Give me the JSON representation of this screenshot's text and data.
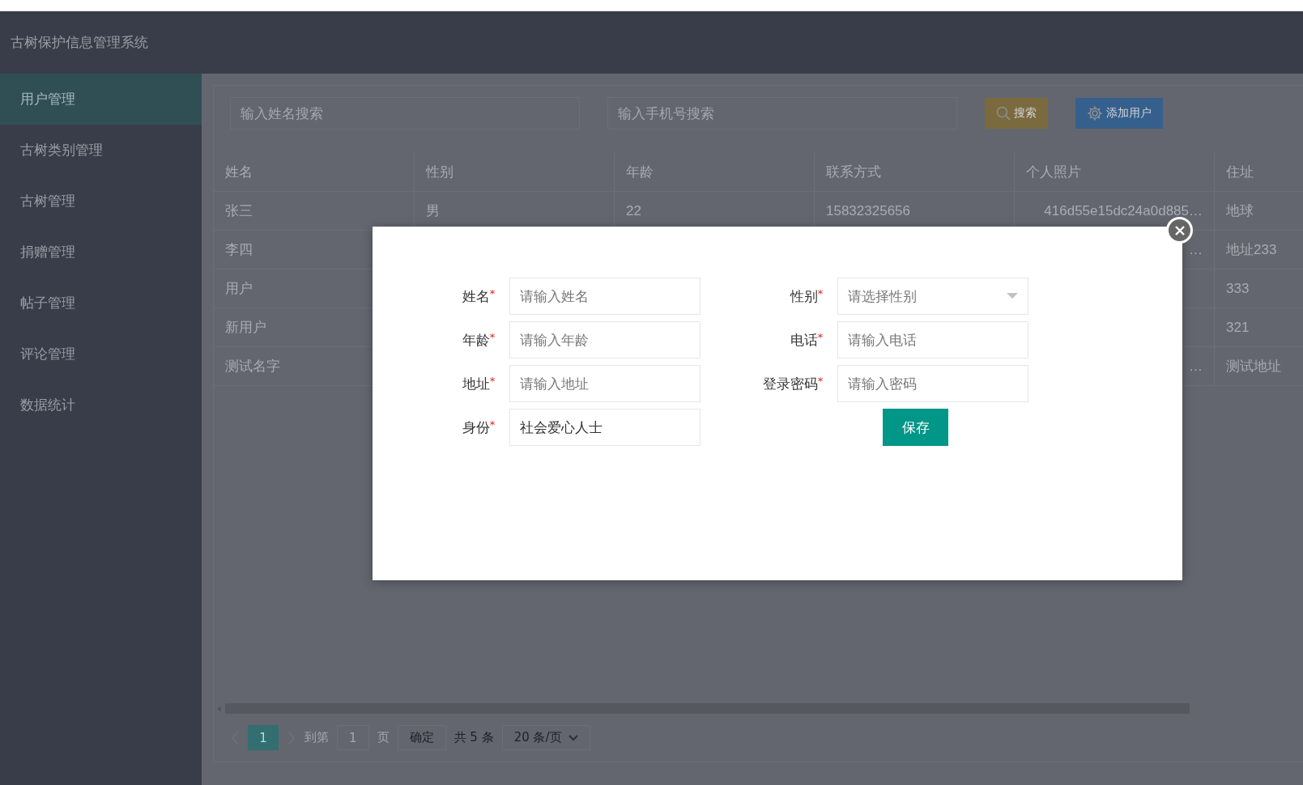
{
  "app_title": "古树保护信息管理系统",
  "sidebar": {
    "items": [
      {
        "label": "用户管理",
        "selected": true
      },
      {
        "label": "古树类别管理",
        "selected": false
      },
      {
        "label": "古树管理",
        "selected": false
      },
      {
        "label": "捐赠管理",
        "selected": false
      },
      {
        "label": "帖子管理",
        "selected": false
      },
      {
        "label": "评论管理",
        "selected": false
      },
      {
        "label": "数据统计",
        "selected": false
      }
    ]
  },
  "search": {
    "name_placeholder": "输入姓名搜索",
    "phone_placeholder": "输入手机号搜索",
    "search_button": "搜索",
    "add_button": "添加用户"
  },
  "table": {
    "columns": [
      "姓名",
      "性别",
      "年龄",
      "联系方式",
      "个人照片",
      "住址"
    ],
    "rows": [
      {
        "name": "张三",
        "gender": "男",
        "age": "22",
        "phone": "15832325656",
        "photo": "416d55e15dc24a0d885…",
        "address": "地球"
      },
      {
        "name": "李四",
        "photo": "…",
        "address": "地址233"
      },
      {
        "name": "用户",
        "address": "333"
      },
      {
        "name": "新用户",
        "address": "321"
      },
      {
        "name": "测试名字",
        "photo": "…",
        "address": "测试地址"
      }
    ]
  },
  "pagination": {
    "pages": [
      {
        "label": "1",
        "selected": true
      }
    ],
    "goto_label": "到第",
    "goto_value": "1",
    "page_unit": "页",
    "confirm": "确定",
    "total": "共 5 条",
    "page_size": "20 条/页"
  },
  "dialog": {
    "fields": [
      {
        "label": "姓名",
        "required_mark": "*",
        "kind": "input",
        "placeholder": "请输入姓名"
      },
      {
        "label": "性别",
        "required_mark": "*",
        "kind": "select",
        "placeholder": "请选择性别"
      },
      {
        "label": "年龄",
        "required_mark": "*",
        "kind": "input",
        "placeholder": "请输入年龄"
      },
      {
        "label": "电话",
        "required_mark": "*",
        "kind": "input",
        "placeholder": "请输入电话"
      },
      {
        "label": "地址",
        "required_mark": "*",
        "kind": "input",
        "placeholder": "请输入地址"
      },
      {
        "label": "登录密码",
        "required_mark": "*",
        "kind": "input",
        "placeholder": "请输入密码"
      },
      {
        "label": "身份",
        "required_mark": "*",
        "kind": "input",
        "value": "社会爱心人士"
      }
    ],
    "save_button": "保存"
  }
}
